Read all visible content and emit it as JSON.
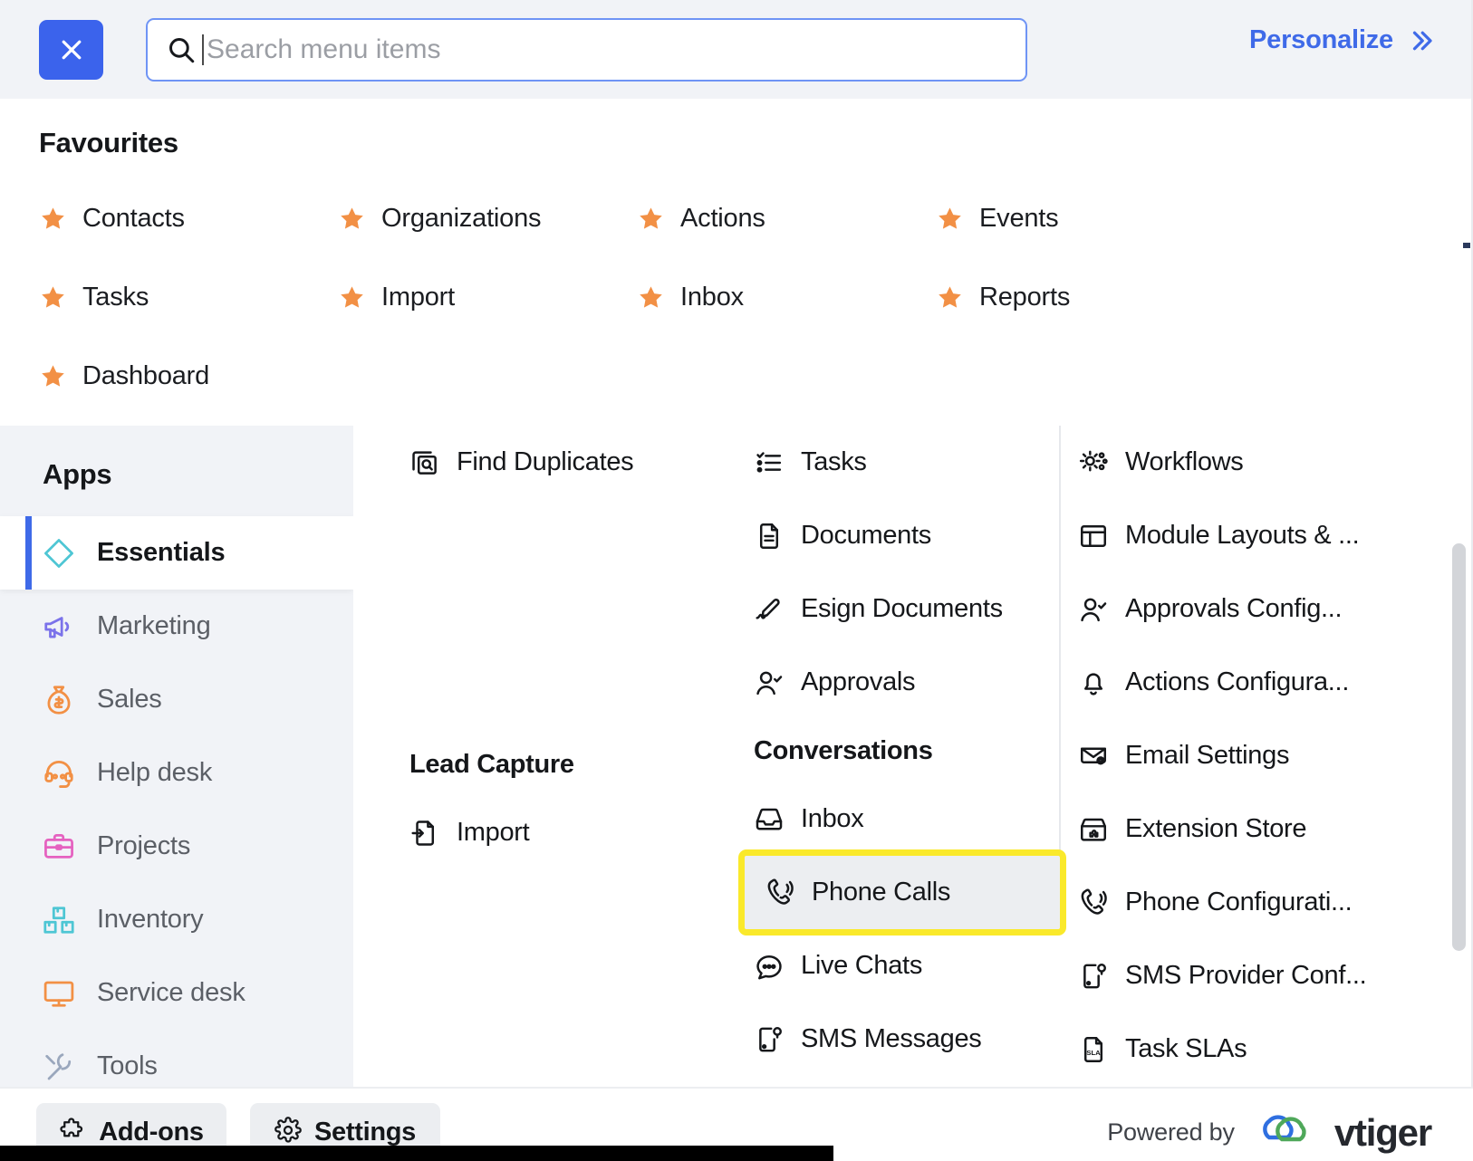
{
  "topbar": {
    "close_label": "close-menu",
    "search_placeholder": "Search menu items",
    "search_value": "",
    "personalize_label": "Personalize"
  },
  "favourites": {
    "title": "Favourites",
    "items": [
      {
        "label": "Contacts",
        "icon": "star-icon"
      },
      {
        "label": "Organizations",
        "icon": "star-icon"
      },
      {
        "label": "Actions",
        "icon": "star-icon"
      },
      {
        "label": "Events",
        "icon": "star-icon"
      },
      {
        "label": "Tasks",
        "icon": "star-icon"
      },
      {
        "label": "Import",
        "icon": "star-icon"
      },
      {
        "label": "Inbox",
        "icon": "star-icon"
      },
      {
        "label": "Reports",
        "icon": "star-icon"
      },
      {
        "label": "Dashboard",
        "icon": "star-icon"
      }
    ]
  },
  "apps": {
    "title": "Apps",
    "items": [
      {
        "label": "Essentials",
        "icon": "diamond-icon",
        "color": "#4ec6d4",
        "active": true
      },
      {
        "label": "Marketing",
        "icon": "megaphone-icon",
        "color": "#7b72ea",
        "active": false
      },
      {
        "label": "Sales",
        "icon": "money-bag-icon",
        "color": "#f29045",
        "active": false
      },
      {
        "label": "Help desk",
        "icon": "headset-icon",
        "color": "#f29045",
        "active": false
      },
      {
        "label": "Projects",
        "icon": "briefcase-icon",
        "color": "#e562c0",
        "active": false
      },
      {
        "label": "Inventory",
        "icon": "boxes-icon",
        "color": "#4ec6d4",
        "active": false
      },
      {
        "label": "Service desk",
        "icon": "monitor-icon",
        "color": "#f29045",
        "active": false
      },
      {
        "label": "Tools",
        "icon": "wrench-icon",
        "color": "#9aa7bd",
        "active": false
      }
    ]
  },
  "columns": {
    "col_a": [
      {
        "type": "item",
        "label": "Find Duplicates",
        "icon": "duplicate-search-icon"
      },
      {
        "type": "gap"
      },
      {
        "type": "group",
        "label": "Lead Capture"
      },
      {
        "type": "item",
        "label": "Import",
        "icon": "import-file-icon"
      }
    ],
    "col_b": [
      {
        "type": "item",
        "label": "Tasks",
        "icon": "checklist-icon"
      },
      {
        "type": "item",
        "label": "Documents",
        "icon": "document-icon"
      },
      {
        "type": "item",
        "label": "Esign Documents",
        "icon": "signature-icon"
      },
      {
        "type": "item",
        "label": "Approvals",
        "icon": "user-check-icon"
      },
      {
        "type": "group",
        "label": "Conversations"
      },
      {
        "type": "item",
        "label": "Inbox",
        "icon": "inbox-tray-icon"
      },
      {
        "type": "item",
        "label": "Phone Calls",
        "icon": "phone-ring-icon",
        "highlighted": true
      },
      {
        "type": "item",
        "label": "Live Chats",
        "icon": "chat-bubble-icon"
      },
      {
        "type": "item",
        "label": "SMS Messages",
        "icon": "sms-device-icon"
      }
    ],
    "col_c": [
      {
        "type": "item",
        "label": "Workflows",
        "icon": "gears-icon"
      },
      {
        "type": "item",
        "label": "Module Layouts & ...",
        "icon": "layout-panel-icon"
      },
      {
        "type": "item",
        "label": "Approvals Config...",
        "icon": "user-check-icon"
      },
      {
        "type": "item",
        "label": "Actions Configura...",
        "icon": "bell-icon"
      },
      {
        "type": "item",
        "label": "Email Settings",
        "icon": "email-gear-icon"
      },
      {
        "type": "item",
        "label": "Extension Store",
        "icon": "extension-store-icon"
      },
      {
        "type": "item",
        "label": "Phone Configurati...",
        "icon": "phone-ring-icon"
      },
      {
        "type": "item",
        "label": "SMS Provider Conf...",
        "icon": "sms-device-icon"
      },
      {
        "type": "item",
        "label": "Task SLAs",
        "icon": "sla-document-icon"
      }
    ]
  },
  "footer": {
    "addons_label": "Add-ons",
    "settings_label": "Settings",
    "powered_by_label": "Powered by",
    "brand_name": "vtiger"
  },
  "colors": {
    "accent_blue": "#3b63ec",
    "link_blue": "#3f6ae8",
    "star_orange": "#f29045",
    "highlight_yellow": "#fae92b",
    "sidebar_bg": "#f1f3f7"
  }
}
